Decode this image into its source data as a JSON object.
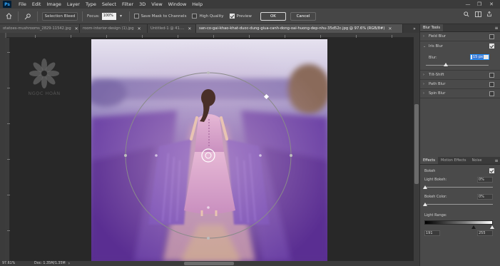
{
  "menubar": {
    "app_icon": "Ps",
    "items": [
      "File",
      "Edit",
      "Image",
      "Layer",
      "Type",
      "Select",
      "Filter",
      "3D",
      "View",
      "Window",
      "Help"
    ],
    "window_controls": [
      "—",
      "❐",
      "✕"
    ]
  },
  "options": {
    "selection_bleed_label": "Selection Bleed",
    "focus_label": "Focus:",
    "focus_value": "100%",
    "save_mask_label": "Save Mask to Channels",
    "high_quality_label": "High Quality",
    "preview_label": "Preview",
    "ok_label": "OK",
    "cancel_label": "Cancel"
  },
  "tabs": [
    {
      "label": "otatoes-mushrooms_2829-11542.jpg",
      "active": false
    },
    {
      "label": "room-interior-design (1).jpg",
      "active": false
    },
    {
      "label": "Untitled-1 @ 41....",
      "active": false
    },
    {
      "label": "san-co-gai-khao-khat-duoc-dung-giua-canh-dong-oai-huong-dep-nhu-35d52c.jpg @ 97.6% (RGB/8#)",
      "active": true
    }
  ],
  "tab_overflow": "»",
  "watermark": {
    "text": "NGỌC HOÀN"
  },
  "status": {
    "zoom": "97.61%",
    "doc": "Doc: 1.35M/1.35M"
  },
  "panel": {
    "tab_title": "Blur Tools",
    "blur_items": [
      {
        "label": "Field Blur",
        "expanded": false,
        "checked": false
      },
      {
        "label": "Iris Blur",
        "expanded": true,
        "checked": true
      },
      {
        "label": "Tilt-Shift",
        "expanded": false,
        "checked": false
      },
      {
        "label": "Path Blur",
        "expanded": false,
        "checked": false
      },
      {
        "label": "Spin Blur",
        "expanded": false,
        "checked": false
      }
    ],
    "blur_label": "Blur:",
    "blur_value": "15 px",
    "effects_tabs": [
      "Effects",
      "Motion Effects",
      "Noise"
    ],
    "bokeh_label": "Bokeh",
    "light_bokeh_label": "Light Bokeh:",
    "light_bokeh_value": "0%",
    "bokeh_color_label": "Bokeh Color:",
    "bokeh_color_value": "0%",
    "light_range_label": "Light Range:",
    "light_range_low": "191",
    "light_range_high": "255"
  },
  "colors": {
    "ui_bg": "#535353",
    "panel_bg": "#4a4a4a",
    "accent_blue": "#31a8ff",
    "lavender": "#7b4fb3"
  }
}
